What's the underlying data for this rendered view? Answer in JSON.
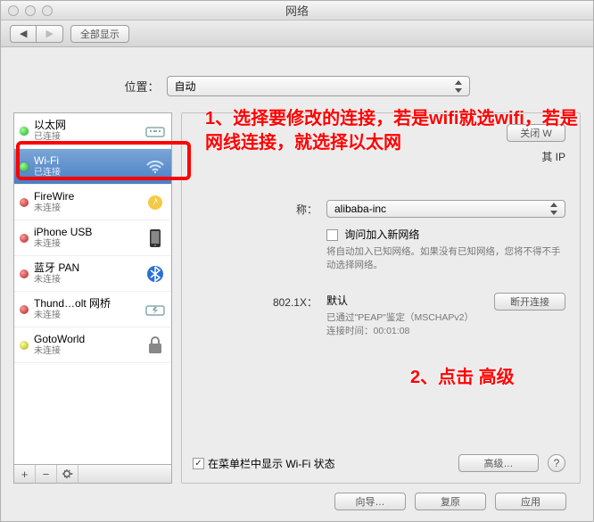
{
  "window": {
    "title": "网络"
  },
  "toolbar": {
    "show_all": "全部显示"
  },
  "location": {
    "label": "位置：",
    "value": "自动"
  },
  "sidebar": {
    "items": [
      {
        "name": "以太网",
        "status": "已连接",
        "dot": "green",
        "icon": "ethernet"
      },
      {
        "name": "Wi-Fi",
        "status": "已连接",
        "dot": "green",
        "icon": "wifi",
        "selected": true
      },
      {
        "name": "FireWire",
        "status": "未连接",
        "dot": "red",
        "icon": "firewire"
      },
      {
        "name": "iPhone USB",
        "status": "未连接",
        "dot": "red",
        "icon": "iphone"
      },
      {
        "name": "蓝牙 PAN",
        "status": "未连接",
        "dot": "red",
        "icon": "bluetooth"
      },
      {
        "name": "Thund…olt 网桥",
        "status": "未连接",
        "dot": "red",
        "icon": "thunderbolt"
      },
      {
        "name": "GotoWorld",
        "status": "未连接",
        "dot": "yellow",
        "icon": "lock"
      }
    ]
  },
  "details": {
    "toggle_button": "关闭 W",
    "ip_fragment": "其 IP",
    "network_name_label": "称：",
    "network_name_value": "alibaba-inc",
    "ask_join_label": "询问加入新网络",
    "ask_join_hint": "将自动加入已知网络。如果没有已知网络，您将不得不手动选择网络。",
    "dot1x_label": "802.1X：",
    "dot1x_value": "默认",
    "disconnect_button": "断开连接",
    "auth_info": "已通过\"PEAP\"鉴定（MSCHAPv2）",
    "time_label": "连接时间：",
    "time_value": "00:01:08",
    "show_menu_label": "在菜单栏中显示 Wi-Fi 状态",
    "advanced_button": "高级…"
  },
  "footer": {
    "assist": "向导…",
    "revert": "复原",
    "apply": "应用"
  },
  "annotations": {
    "a1": "1、选择要修改的连接，若是wifi就选wifi，若是网线连接，就选择以太网",
    "a2": "2、点击 高级"
  }
}
